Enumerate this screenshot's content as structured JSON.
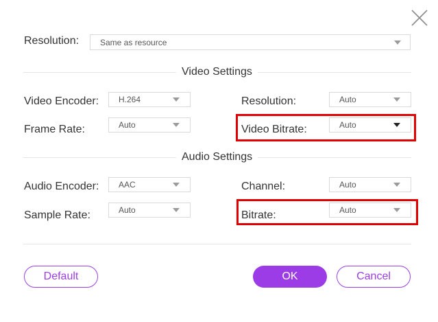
{
  "resolution": {
    "label": "Resolution:",
    "value": "Same as resource"
  },
  "video_section": {
    "title": "Video Settings",
    "encoder_label": "Video Encoder:",
    "encoder_value": "H.264",
    "resolution_label": "Resolution:",
    "resolution_value": "Auto",
    "frame_rate_label": "Frame Rate:",
    "frame_rate_value": "Auto",
    "bitrate_label": "Video Bitrate:",
    "bitrate_value": "Auto"
  },
  "audio_section": {
    "title": "Audio Settings",
    "encoder_label": "Audio Encoder:",
    "encoder_value": "AAC",
    "channel_label": "Channel:",
    "channel_value": "Auto",
    "sample_rate_label": "Sample Rate:",
    "sample_rate_value": "Auto",
    "bitrate_label": "Bitrate:",
    "bitrate_value": "Auto"
  },
  "buttons": {
    "default_label": "Default",
    "ok_label": "OK",
    "cancel_label": "Cancel"
  },
  "icons": {
    "close": "close-icon",
    "dropdown": "chevron-down-icon"
  },
  "colors": {
    "accent": "#9b3ce6",
    "highlight": "#e00000"
  }
}
